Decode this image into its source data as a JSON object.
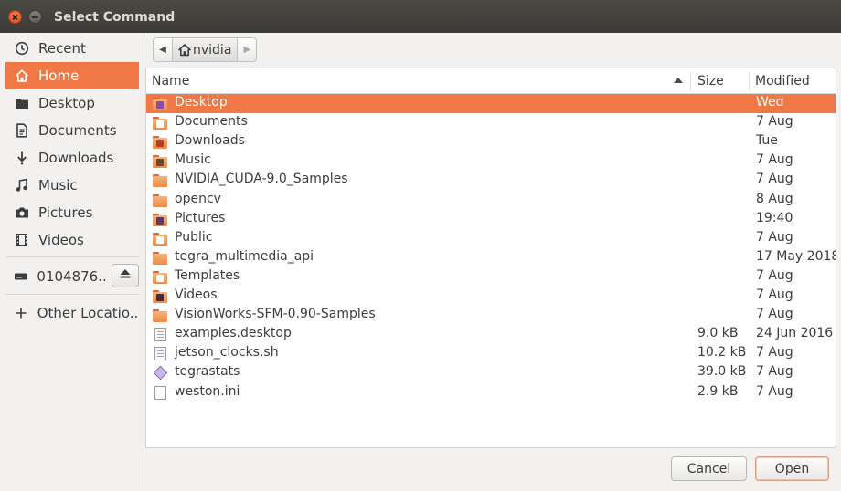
{
  "window": {
    "title": "Select Command"
  },
  "sidebar": {
    "items": [
      {
        "label": "Recent",
        "icon": "clock-icon"
      },
      {
        "label": "Home",
        "icon": "home-icon",
        "selected": true
      },
      {
        "label": "Desktop",
        "icon": "folder-icon"
      },
      {
        "label": "Documents",
        "icon": "document-icon"
      },
      {
        "label": "Downloads",
        "icon": "download-arrow-icon"
      },
      {
        "label": "Music",
        "icon": "music-note-icon"
      },
      {
        "label": "Pictures",
        "icon": "camera-icon"
      },
      {
        "label": "Videos",
        "icon": "film-icon"
      }
    ],
    "drive": {
      "label": "0104876...",
      "icon": "drive-icon",
      "eject_icon": "eject-icon"
    },
    "other": {
      "label": "Other Locatio...",
      "icon": "plus-icon"
    }
  },
  "pathbar": {
    "crumb": "nvidia",
    "crumb_icon": "home-icon"
  },
  "columns": {
    "name": "Name",
    "size": "Size",
    "modified": "Modified",
    "sort": "ascending"
  },
  "files": [
    {
      "name": "Desktop",
      "size": "",
      "modified": "Wed",
      "type": "folder-desktop",
      "selected": true
    },
    {
      "name": "Documents",
      "size": "",
      "modified": "7 Aug",
      "type": "folder-documents"
    },
    {
      "name": "Downloads",
      "size": "",
      "modified": "Tue",
      "type": "folder-downloads"
    },
    {
      "name": "Music",
      "size": "",
      "modified": "7 Aug",
      "type": "folder-music"
    },
    {
      "name": "NVIDIA_CUDA-9.0_Samples",
      "size": "",
      "modified": "7 Aug",
      "type": "folder"
    },
    {
      "name": "opencv",
      "size": "",
      "modified": "8 Aug",
      "type": "folder"
    },
    {
      "name": "Pictures",
      "size": "",
      "modified": "19:40",
      "type": "folder-pictures"
    },
    {
      "name": "Public",
      "size": "",
      "modified": "7 Aug",
      "type": "folder-public"
    },
    {
      "name": "tegra_multimedia_api",
      "size": "",
      "modified": "17 May 2018",
      "type": "folder"
    },
    {
      "name": "Templates",
      "size": "",
      "modified": "7 Aug",
      "type": "folder-templates"
    },
    {
      "name": "Videos",
      "size": "",
      "modified": "7 Aug",
      "type": "folder-videos"
    },
    {
      "name": "VisionWorks-SFM-0.90-Samples",
      "size": "",
      "modified": "7 Aug",
      "type": "folder"
    },
    {
      "name": "examples.desktop",
      "size": "9.0 kB",
      "modified": "24 Jun 2016",
      "type": "text-file"
    },
    {
      "name": "jetson_clocks.sh",
      "size": "10.2 kB",
      "modified": "7 Aug",
      "type": "text-file"
    },
    {
      "name": "tegrastats",
      "size": "39.0 kB",
      "modified": "7 Aug",
      "type": "executable"
    },
    {
      "name": "weston.ini",
      "size": "2.9 kB",
      "modified": "7 Aug",
      "type": "blank-file"
    }
  ],
  "buttons": {
    "cancel": "Cancel",
    "open": "Open"
  },
  "colors": {
    "accent": "#f07746",
    "titlebar": "#3c3b37",
    "folder": "#f29e5f"
  }
}
